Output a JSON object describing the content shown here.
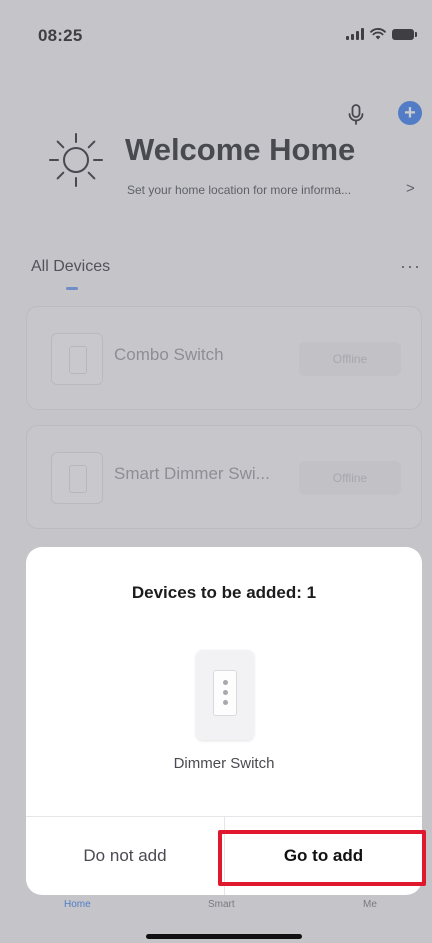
{
  "status_bar": {
    "time": "08:25"
  },
  "icons": {
    "mic": "microphone-icon",
    "plus": "plus-icon",
    "sun": "sun-icon",
    "more": "more-icon"
  },
  "header": {
    "welcome_title": "Welcome Home",
    "welcome_subtitle": "Set your home location for more informa...",
    "chevron": ">"
  },
  "devices_section": {
    "title": "All Devices",
    "more": "···"
  },
  "devices": [
    {
      "name": "Combo Switch",
      "status": "Offline"
    },
    {
      "name": "Smart Dimmer Swi...",
      "status": "Offline"
    }
  ],
  "modal": {
    "title": "Devices to be added: 1",
    "device_label": "Dimmer Switch",
    "cancel_label": "Do not add",
    "confirm_label": "Go to add"
  },
  "tabbar": {
    "home": "Home",
    "smart": "Smart",
    "me": "Me"
  },
  "colors": {
    "accent": "#3b7ff0",
    "highlight": "#e0182d"
  }
}
